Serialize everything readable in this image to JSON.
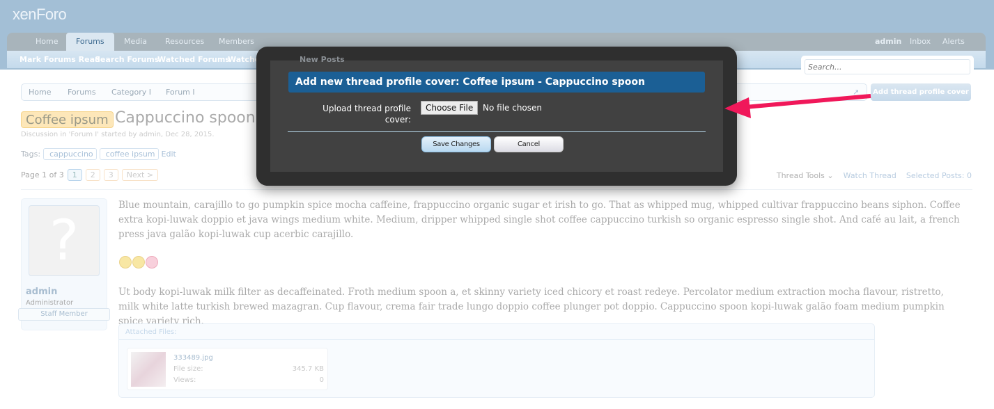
{
  "logo": "xenForo",
  "nav": {
    "tabs": [
      "Home",
      "Forums",
      "Media",
      "Resources",
      "Members"
    ],
    "selected": "Forums",
    "right": [
      "admin",
      "Inbox",
      "Alerts"
    ]
  },
  "subnav": [
    "Mark Forums Read",
    "Search Forums",
    "Watched Forums",
    "Watched Threads",
    "New Posts"
  ],
  "search": {
    "placeholder": "Search..."
  },
  "breadcrumb": [
    "Home",
    "Forums",
    "Category I",
    "Forum I"
  ],
  "add_cover_button": "Add thread profile cover",
  "thread": {
    "prefix": "Coffee ipsum",
    "title": "Cappuccino spoon",
    "meta": "Discussion in 'Forum I' started by admin, Dec 28, 2015.",
    "tags_label": "Tags:",
    "tags": [
      "cappuccino",
      "coffee ipsum"
    ],
    "tags_edit": "Edit"
  },
  "pagination": {
    "label": "Page 1 of 3",
    "pages": [
      "1",
      "2",
      "3"
    ],
    "current": "1",
    "next": "Next >"
  },
  "tools": {
    "thread_tools": "Thread Tools",
    "watch": "Watch Thread",
    "selected": "Selected Posts: 0"
  },
  "post": {
    "username": "admin",
    "user_title": "Administrator",
    "banner": "Staff Member",
    "p1": "Blue mountain, carajillo to go pumpkin spice mocha caffeine, frappuccino organic sugar et irish to go. That as whipped mug, whipped cultivar frappuccino beans siphon. Coffee extra kopi-luwak doppio et java wings medium white. Medium, dripper whipped single shot coffee cappuccino turkish so organic espresso single shot. And café au lait, a french press java galão kopi-luwak cup acerbic carajillo.",
    "p2": "Ut body kopi-luwak milk filter as decaffeinated. Froth medium spoon a, et skinny variety iced chicory et roast redeye. Percolator medium extraction mocha flavour, ristretto, milk white latte turkish brewed mazagran. Cup flavour, crema fair trade lungo doppio coffee plunger pot doppio. Cappuccino spoon kopi-luwak galão foam medium pumpkin spice variety rich.",
    "attachments": {
      "header": "Attached Files:",
      "file": {
        "name": "333489.jpg",
        "size_label": "File size:",
        "size": "345.7 KB",
        "views_label": "Views:",
        "views": "0"
      }
    }
  },
  "modal": {
    "title": "Add new thread profile cover: Coffee ipsum - Cappuccino spoon",
    "upload_label": "Upload thread profile cover:",
    "choose_file": "Choose File",
    "no_file": "No file chosen",
    "save": "Save Changes",
    "cancel": "Cancel"
  },
  "colors": {
    "modal_title_bg": "#1b5f95",
    "arrow": "#f0185a",
    "header": "#a3bfd6"
  }
}
